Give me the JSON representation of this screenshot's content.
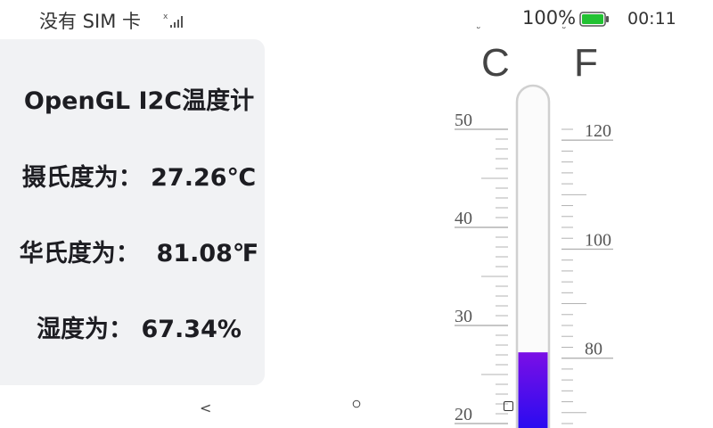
{
  "status_bar": {
    "carrier": "没有 SIM 卡",
    "battery_percent": "100%",
    "time": "00:11",
    "battery_color": "#22c232"
  },
  "panel": {
    "title": "OpenGL I2C温度计",
    "celsius_label": "摄氏度为：",
    "celsius_value": "27.26℃",
    "fahrenheit_label": "华氏度为：",
    "fahrenheit_value": "81.08℉",
    "humidity_label": "湿度为：",
    "humidity_value": "67.34%"
  },
  "thermometer": {
    "celsius_unit": "C",
    "fahrenheit_unit": "F",
    "degree_mark": "°",
    "celsius_labels": [
      "50",
      "40",
      "30",
      "20"
    ],
    "fahrenheit_labels": [
      "120",
      "100",
      "80"
    ],
    "level_celsius": 27.26,
    "fill_top_color": "#7b0fe6",
    "fill_bottom_color": "#2a0cf0"
  },
  "nav": {
    "back_symbol": "<"
  }
}
